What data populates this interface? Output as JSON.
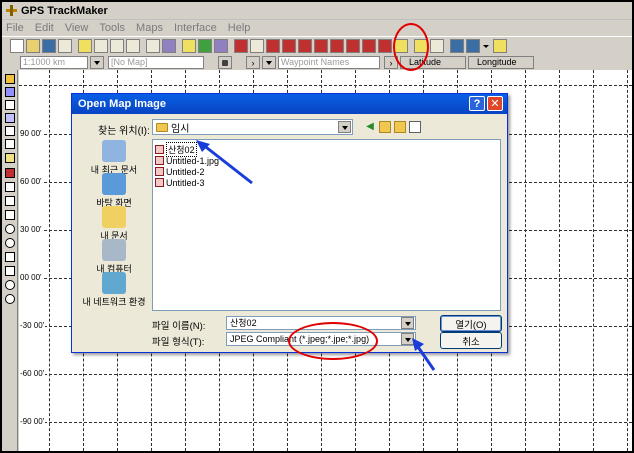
{
  "app": {
    "title": "GPS TrackMaker"
  },
  "menu": [
    "File",
    "Edit",
    "View",
    "Tools",
    "Maps",
    "Interface",
    "Help"
  ],
  "toolbar2": {
    "scale_value": "1:1000 km",
    "map_value": "[No Map]",
    "waypoint_placeholder": "Waypoint Names",
    "latitude_label": "Latitude",
    "longitude_label": "Longitude"
  },
  "map": {
    "latitude_labels": [
      "90 00'",
      "60 00'",
      "30 00'",
      "00 00'",
      "-30 00'",
      "-60 00'",
      "-90 00'"
    ]
  },
  "dialog": {
    "title": "Open Map Image",
    "help_glyph": "?",
    "close_glyph": "✕",
    "look_in_label": "찾는 위치(I):",
    "look_in_value": "임시",
    "places": [
      {
        "label": "내 최근 문서",
        "color": "#8fb4e0"
      },
      {
        "label": "바탕 화면",
        "color": "#5a9ad8"
      },
      {
        "label": "내 문서",
        "color": "#f0d060"
      },
      {
        "label": "내 컴퓨터",
        "color": "#a8b8c8"
      },
      {
        "label": "내 네트워크 환경",
        "color": "#60a8d0"
      }
    ],
    "files": [
      "산청02",
      "Untitled-1.jpg",
      "Untitled-2",
      "Untitled-3"
    ],
    "file_name_label": "파일 이름(N):",
    "file_name_value": "산청02",
    "file_type_label": "파일 형식(T):",
    "file_type_value": "JPEG Compliant (*.jpeg;*.jpe;*.jpg)",
    "open_button": "열기(O)",
    "cancel_button": "취소"
  },
  "colors": {
    "annotation_red": "#e00000",
    "annotation_blue": "#1a3cd8",
    "dialog_title": "#0a5fe6"
  }
}
